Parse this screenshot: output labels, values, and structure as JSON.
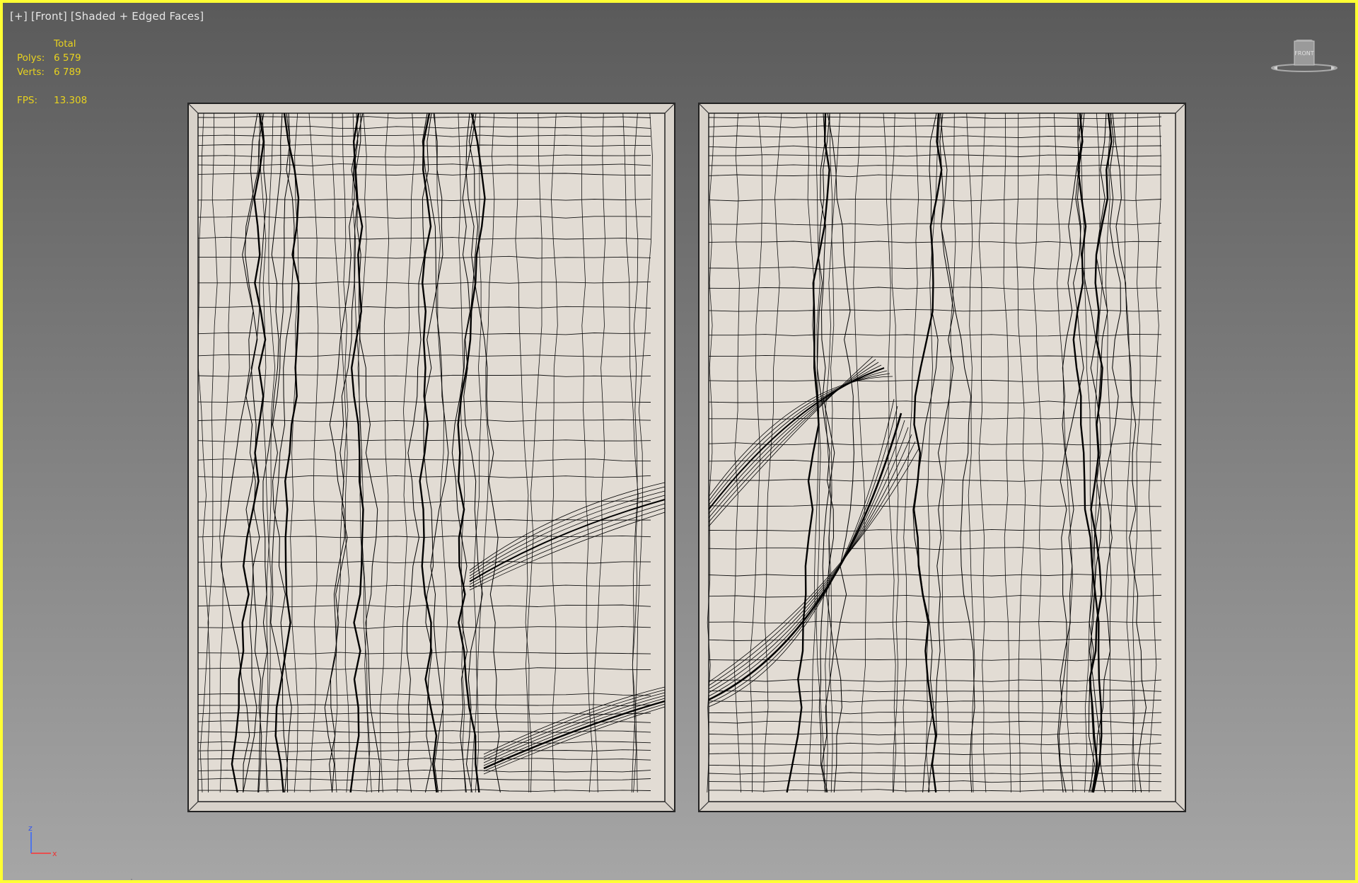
{
  "viewport": {
    "label_plus": "[+]",
    "label_view": "[Front]",
    "label_mode": "[Shaded + Edged Faces]"
  },
  "stats": {
    "total_label": "Total",
    "polys_label": "Polys:",
    "polys_value": "6 579",
    "verts_label": "Verts:",
    "verts_value": "6 789",
    "fps_label": "FPS:",
    "fps_value": "13.308"
  },
  "viewcube": {
    "face_label": "FRONT"
  },
  "axis": {
    "z_label": "z",
    "x_label": "x"
  },
  "colors": {
    "border": "#ffff33",
    "stats_text": "#e8d21e",
    "panel_face": "#e2dcd4",
    "panel_frame": "#d8d2ca",
    "wire": "#111111"
  },
  "icons": [
    "viewcube-icon",
    "axis-tripod-icon"
  ]
}
